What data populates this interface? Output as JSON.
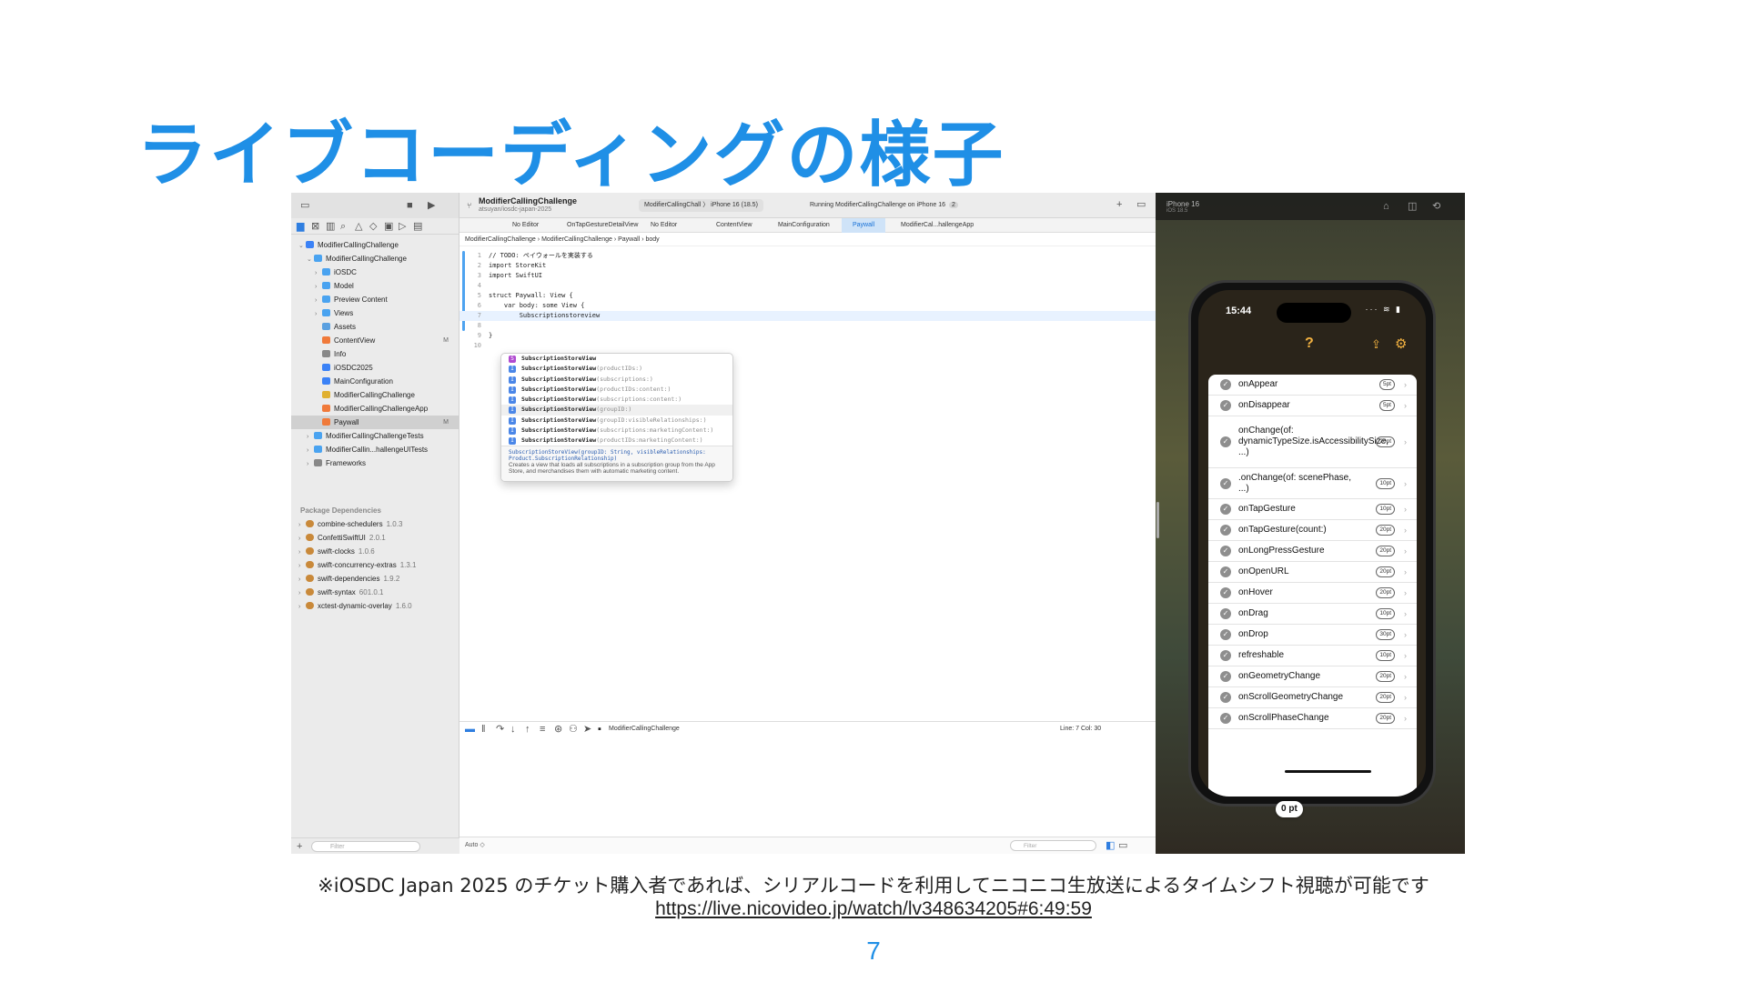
{
  "slide": {
    "title": "ライブコーディングの様子",
    "note": "※iOSDC Japan 2025 のチケット購入者であれば、シリアルコードを利用してニコニコ生放送によるタイムシフト視聴が可能です",
    "url": "https://live.nicovideo.jp/watch/lv348634205#6:49:59",
    "page": "7"
  },
  "xcode": {
    "project_title": "ModifierCallingChallenge",
    "project_subtitle": "atsuyan/iosdc-japan-2025",
    "scheme": "ModifierCallingChall",
    "device": "iPhone 16 (18.5)",
    "run_status": "Running ModifierCallingChallenge on iPhone 16",
    "run_badge": "2",
    "tabs": [
      "No Editor",
      "OnTapGestureDetailView",
      "No Editor",
      "ContentView",
      "MainConfiguration",
      "Paywall",
      "ModifierCal...hallengeApp"
    ],
    "jump_bar": [
      "ModifierCallingChallenge",
      "ModifierCallingChallenge",
      "Paywall",
      "body"
    ],
    "navigator": [
      {
        "label": "ModifierCallingChallenge",
        "indent": 0,
        "chev": "⌄",
        "color": "#3b82f6"
      },
      {
        "label": "ModifierCallingChallenge",
        "indent": 1,
        "chev": "⌄",
        "color": "#4aa3f0"
      },
      {
        "label": "iOSDC",
        "indent": 2,
        "chev": "›",
        "color": "#4aa3f0"
      },
      {
        "label": "Model",
        "indent": 2,
        "chev": "›",
        "color": "#4aa3f0"
      },
      {
        "label": "Preview Content",
        "indent": 2,
        "chev": "›",
        "color": "#4aa3f0"
      },
      {
        "label": "Views",
        "indent": 2,
        "chev": "›",
        "color": "#4aa3f0"
      },
      {
        "label": "Assets",
        "indent": 2,
        "chev": "",
        "color": "#5aa0e0"
      },
      {
        "label": "ContentView",
        "indent": 2,
        "chev": "",
        "color": "#f07a3a",
        "mark": "M"
      },
      {
        "label": "Info",
        "indent": 2,
        "chev": "",
        "color": "#888888"
      },
      {
        "label": "iOSDC2025",
        "indent": 2,
        "chev": "",
        "color": "#3b82f6"
      },
      {
        "label": "MainConfiguration",
        "indent": 2,
        "chev": "",
        "color": "#3b82f6"
      },
      {
        "label": "ModifierCallingChallenge",
        "indent": 2,
        "chev": "",
        "color": "#e0b030"
      },
      {
        "label": "ModifierCallingChallengeApp",
        "indent": 2,
        "chev": "",
        "color": "#f07a3a"
      },
      {
        "label": "Paywall",
        "indent": 2,
        "chev": "",
        "color": "#f07a3a",
        "mark": "M",
        "selected": true
      },
      {
        "label": "ModifierCallingChallengeTests",
        "indent": 1,
        "chev": "›",
        "color": "#4aa3f0"
      },
      {
        "label": "ModifierCallin...hallengeUITests",
        "indent": 1,
        "chev": "›",
        "color": "#4aa3f0"
      },
      {
        "label": "Frameworks",
        "indent": 1,
        "chev": "›",
        "color": "#888888"
      }
    ],
    "package_header": "Package Dependencies",
    "packages": [
      {
        "name": "combine-schedulers",
        "ver": "1.0.3"
      },
      {
        "name": "ConfettiSwiftUI",
        "ver": "2.0.1"
      },
      {
        "name": "swift-clocks",
        "ver": "1.0.6"
      },
      {
        "name": "swift-concurrency-extras",
        "ver": "1.3.1"
      },
      {
        "name": "swift-dependencies",
        "ver": "1.9.2"
      },
      {
        "name": "swift-syntax",
        "ver": "601.0.1"
      },
      {
        "name": "xctest-dynamic-overlay",
        "ver": "1.6.0"
      }
    ],
    "filter_placeholder": "Filter",
    "code": [
      {
        "n": "1",
        "t": "// TODO: ペイウォールを実装する",
        "cls": "cm"
      },
      {
        "n": "2",
        "t": "import StoreKit",
        "cls": ""
      },
      {
        "n": "3",
        "t": "import SwiftUI",
        "cls": ""
      },
      {
        "n": "4",
        "t": "",
        "cls": ""
      },
      {
        "n": "5",
        "t": "struct Paywall: View {",
        "cls": ""
      },
      {
        "n": "6",
        "t": "    var body: some View {",
        "cls": ""
      },
      {
        "n": "7",
        "t": "        Subscriptionstoreview",
        "cls": "",
        "current": true
      },
      {
        "n": "8",
        "t": "",
        "cls": ""
      },
      {
        "n": "9",
        "t": "}",
        "cls": ""
      },
      {
        "n": "10",
        "t": "",
        "cls": ""
      }
    ],
    "autocomplete": [
      {
        "k": "S",
        "name": "SubscriptionStoreView",
        "params": ""
      },
      {
        "k": "I",
        "name": "SubscriptionStoreView",
        "params": "(productIDs:)"
      },
      {
        "k": "I",
        "name": "SubscriptionStoreView",
        "params": "(subscriptions:)"
      },
      {
        "k": "I",
        "name": "SubscriptionStoreView",
        "params": "(productIDs:content:)"
      },
      {
        "k": "I",
        "name": "SubscriptionStoreView",
        "params": "(subscriptions:content:)"
      },
      {
        "k": "I",
        "name": "SubscriptionStoreView",
        "params": "(groupID:)",
        "hl": true
      },
      {
        "k": "I",
        "name": "SubscriptionStoreView",
        "params": "(groupID:visibleRelationships:)"
      },
      {
        "k": "I",
        "name": "SubscriptionStoreView",
        "params": "(subscriptions:marketingContent:)"
      },
      {
        "k": "I",
        "name": "SubscriptionStoreView",
        "params": "(productIDs:marketingContent:)"
      }
    ],
    "ac_doc_sig": "SubscriptionStoreView(groupID: String, visibleRelationships: Product.SubscriptionRelationship)",
    "ac_doc_text": "Creates a view that loads all subscriptions in a subscription group from the App Store, and merchandises them with automatic marketing content.",
    "debug_target": "ModifierCallingChallenge",
    "line_col": "Line: 7  Col: 30",
    "auto_label": "Auto ◇",
    "editor_filter": "Filter"
  },
  "simulator": {
    "device": "iPhone 16",
    "ios": "iOS 18.5",
    "time": "15:44",
    "toast": "0 pt",
    "rows": [
      {
        "label": "onAppear",
        "pt": "5pt",
        "h": 23
      },
      {
        "label": "onDisappear",
        "pt": "5pt",
        "h": 23
      },
      {
        "label": "onChange(of: dynamicTypeSize.isAccessibilitySize, ...)",
        "pt": "20pt",
        "h": 57
      },
      {
        "label": ".onChange(of: scenePhase, ...)",
        "pt": "10pt",
        "h": 34
      },
      {
        "label": "onTapGesture",
        "pt": "10pt",
        "h": 23
      },
      {
        "label": "onTapGesture(count:)",
        "pt": "20pt",
        "h": 23
      },
      {
        "label": "onLongPressGesture",
        "pt": "20pt",
        "h": 23
      },
      {
        "label": "onOpenURL",
        "pt": "20pt",
        "h": 23
      },
      {
        "label": "onHover",
        "pt": "20pt",
        "h": 23
      },
      {
        "label": "onDrag",
        "pt": "10pt",
        "h": 23
      },
      {
        "label": "onDrop",
        "pt": "30pt",
        "h": 23
      },
      {
        "label": "refreshable",
        "pt": "10pt",
        "h": 23
      },
      {
        "label": "onGeometryChange",
        "pt": "20pt",
        "h": 23
      },
      {
        "label": "onScrollGeometryChange",
        "pt": "20pt",
        "h": 23
      },
      {
        "label": "onScrollPhaseChange",
        "pt": "20pt",
        "h": 23
      }
    ]
  }
}
